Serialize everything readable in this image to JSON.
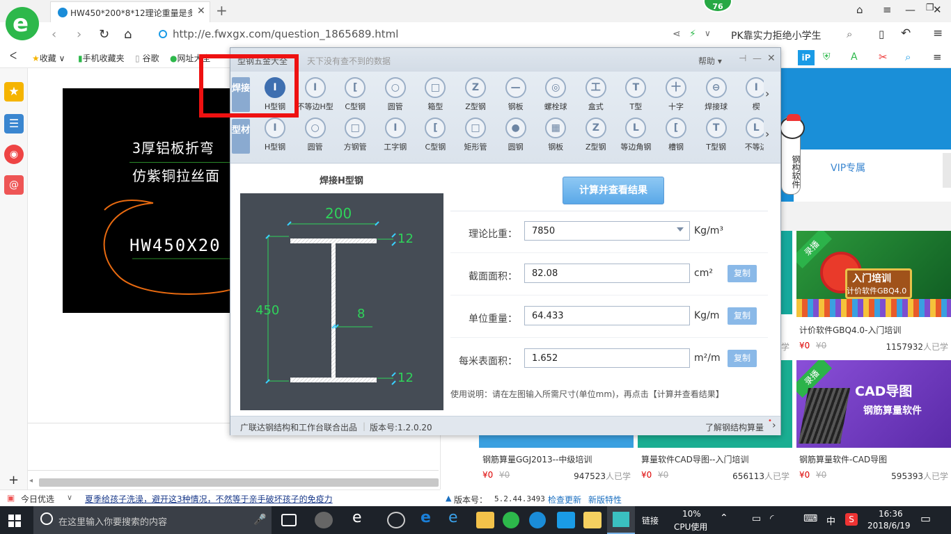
{
  "browser": {
    "tab_title": "HW450*200*8*12理论重量是多",
    "badge": "76",
    "url": "http://e.fwxgx.com/question_1865689.html",
    "search_text": "PK靠实力拒绝小学生"
  },
  "bookmarks": [
    "收藏",
    "手机收藏夹",
    "谷歌",
    "网址大全"
  ],
  "cad": {
    "line1": "3厚铝板折弯",
    "line2": "仿紫铜拉丝面",
    "line3": "HW450X20"
  },
  "dialog": {
    "title": "型钢五金大全",
    "slogan": "天下没有查不到的数据",
    "help": "帮助",
    "tabs": {
      "weld": "焊接",
      "profile": "型材"
    },
    "row1": [
      "H型钢",
      "不等边H型",
      "C型钢",
      "圆管",
      "箱型",
      "Z型钢",
      "钢板",
      "螺栓球",
      "盒式",
      "T型",
      "十字",
      "焊接球",
      "楔"
    ],
    "row1_glyphs": [
      "I",
      "I",
      "[",
      "○",
      "□",
      "Z",
      "—",
      "◎",
      "工",
      "T",
      "十",
      "⊖",
      "I"
    ],
    "row2": [
      "H型钢",
      "圆管",
      "方钢管",
      "工字钢",
      "C型钢",
      "矩形管",
      "圆钢",
      "钢板",
      "Z型钢",
      "等边角钢",
      "槽钢",
      "T型钢",
      "不等边"
    ],
    "row2_glyphs": [
      "I",
      "○",
      "□",
      "I",
      "[",
      "□",
      "●",
      "▦",
      "Z",
      "L",
      "[",
      "T",
      "L"
    ],
    "figure_title": "焊接H型钢",
    "dims": {
      "width": "200",
      "height": "450",
      "flange_top": "12",
      "flange_bottom": "12",
      "web": "8"
    },
    "calc_button": "计算并查看结果",
    "fields": {
      "density": {
        "label": "理论比重：",
        "value": "7850",
        "unit": "Kg/m³"
      },
      "area": {
        "label": "截面面积：",
        "value": "82.08",
        "unit": "cm²"
      },
      "unit_weight": {
        "label": "单位重量：",
        "value": "64.433",
        "unit": "Kg/m"
      },
      "surface": {
        "label": "每米表面积：",
        "value": "1.652",
        "unit": "m²/m"
      }
    },
    "copy_label": "复制",
    "usage": "使用说明：请在左图输入所需尺寸(单位mm)，再点击【计算并查看结果】",
    "footer_left": "广联达钢结构和工作台联合出品",
    "version": "版本号:1.2.0.20",
    "footer_right": "了解钢结构算量"
  },
  "right_page": {
    "vip": "VIP专属",
    "mascot_text": "钢构软件",
    "courses": [
      {
        "title": "计价软件GBQ4.0-入门培训",
        "price": "¥0",
        "orig": "¥0",
        "learners": "1157932",
        "suffix": "人已学",
        "badge": "录播",
        "banner1": "入门培训",
        "banner2": "计价软件GBQ4.0"
      },
      {
        "title": "钢筋算量GGJ2013--中级培训",
        "price": "¥0",
        "orig": "¥0",
        "learners": "947523",
        "suffix": "人已学"
      },
      {
        "title": "算量软件CAD导图--入门培训",
        "price": "¥0",
        "orig": "¥0",
        "learners": "656113",
        "suffix": "人已学"
      },
      {
        "title": "钢筋算量软件-CAD导图",
        "price": "¥0",
        "orig": "¥0",
        "learners": "595393",
        "suffix": "人已学",
        "badge": "录播",
        "banner1": "CAD导图",
        "banner2": "钢筋算量软件"
      }
    ],
    "partial_learn": "学",
    "version_label": "版本号：",
    "version_value": "5.2.44.3493",
    "check_update": "检查更新",
    "new_features": "新版特性"
  },
  "bottom_news": {
    "label": "今日优选",
    "text": "夏季给孩子洗澡，避开这3种情况，不然等于亲手破坏孩子的免疫力"
  },
  "taskbar": {
    "search_placeholder": "在这里输入你要搜索的内容",
    "link": "链接",
    "cpu_pct": "10%",
    "cpu_label": "CPU使用",
    "ime": "中",
    "time": "16:36",
    "date": "2018/6/19"
  },
  "colors": {
    "accent": "#3e6fb0",
    "dim_green": "#2fd35a",
    "red_box": "#ee1111"
  }
}
